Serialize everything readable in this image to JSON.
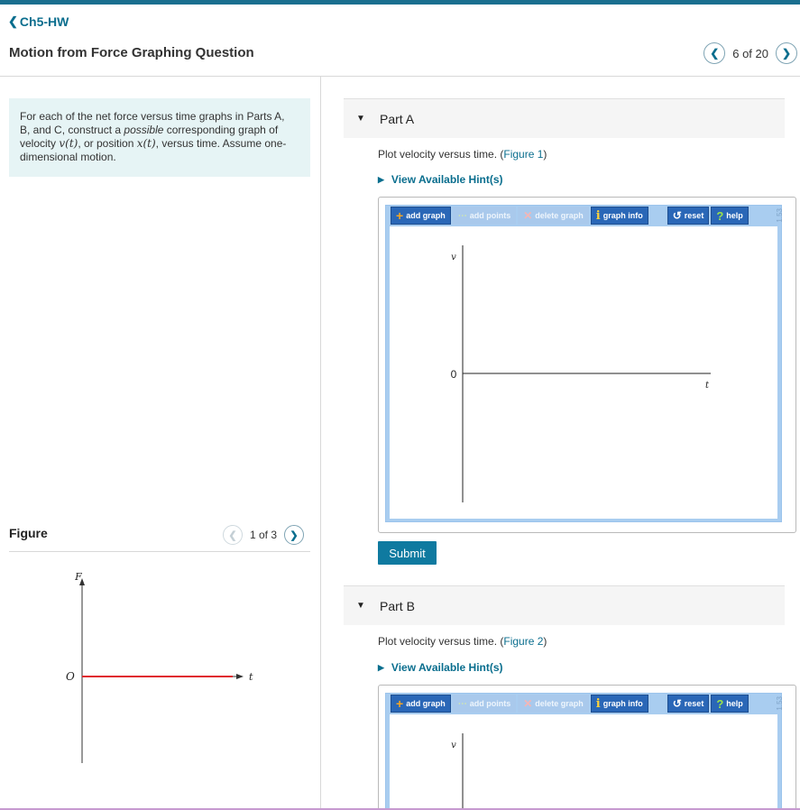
{
  "header": {
    "back_label": "Ch5-HW",
    "title": "Motion from Force Graphing Question",
    "pager": "6 of 20"
  },
  "intro": {
    "line1": "For each of the net force versus time graphs in Parts A,",
    "line2a": "B, and C, construct a ",
    "line2_italic": "possible",
    "line2b": " corresponding graph of",
    "line3a": "velocity ",
    "v_of_t": "v(t)",
    "line3b": ", or position ",
    "x_of_t": "x(t)",
    "line3c": ", versus time. Assume one-",
    "line4": "dimensional motion."
  },
  "figure": {
    "label": "Figure",
    "pager": "1 of 3",
    "axis_y": "F",
    "axis_x": "t",
    "origin": "O",
    "line_color": "#e0262f"
  },
  "parts": [
    {
      "title": "Part A",
      "prompt": "Plot velocity versus time. (",
      "figure_link": "Figure 1",
      "prompt_end": ")",
      "hint": "View Available Hint(s)",
      "graph": {
        "y_label": "v",
        "x_label": "t",
        "zero": "0"
      }
    },
    {
      "title": "Part B",
      "prompt": "Plot velocity versus time. (",
      "figure_link": "Figure 2",
      "prompt_end": ")",
      "hint": "View Available Hint(s)",
      "graph": {
        "y_label": "v"
      }
    }
  ],
  "toolbar": {
    "add_graph": "add graph",
    "add_points": "add points",
    "delete_graph": "delete graph",
    "graph_info": "graph info",
    "reset": "reset",
    "help": "help",
    "version": "1.53"
  },
  "submit_label": "Submit",
  "colors": {
    "accent": "#0a6e8e",
    "toolbar_blue": "#2a67b7",
    "graph_border": "#a9cdf0",
    "intro_bg": "#e6f4f5"
  }
}
